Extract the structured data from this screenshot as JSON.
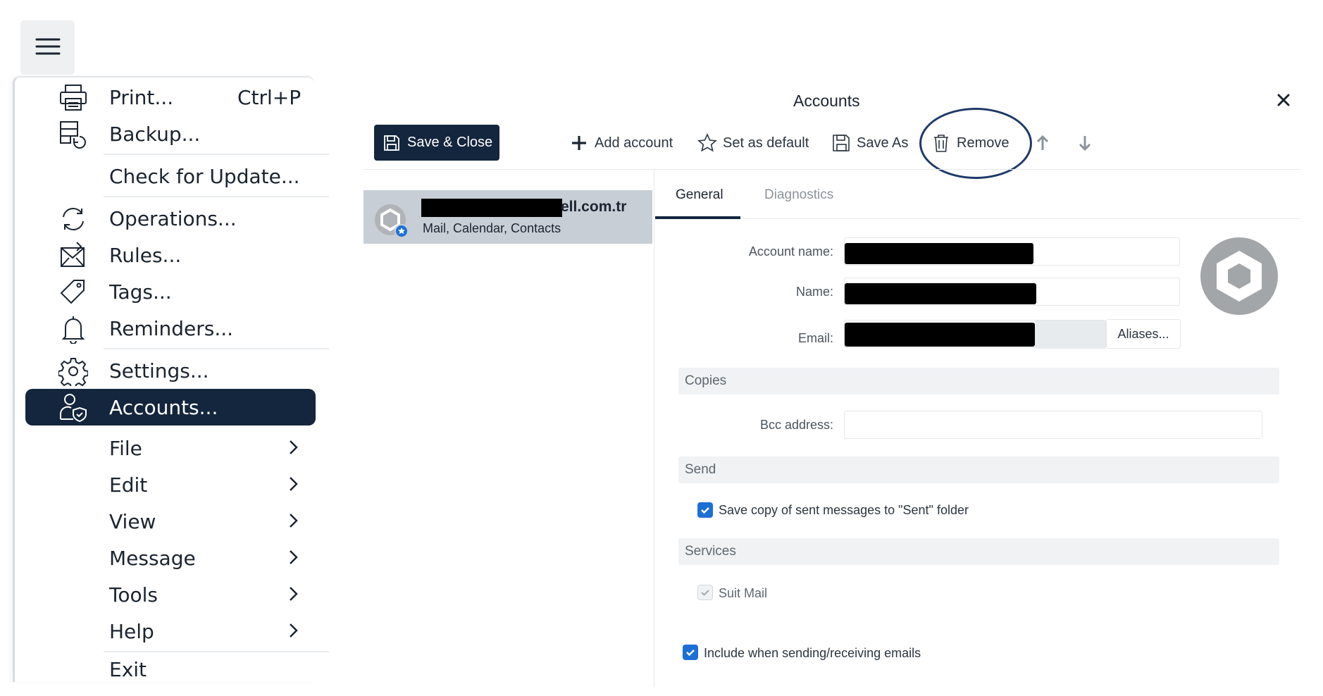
{
  "menu": {
    "items": [
      {
        "label": "Print...",
        "shortcut": "Ctrl+P",
        "icon": "printer-icon"
      },
      {
        "label": "Backup...",
        "icon": "backup-icon"
      },
      {
        "label": "Check for Update...",
        "icon": ""
      },
      {
        "label": "Operations...",
        "icon": "sync-icon"
      },
      {
        "label": "Rules...",
        "icon": "rules-icon"
      },
      {
        "label": "Tags...",
        "icon": "tag-icon"
      },
      {
        "label": "Reminders...",
        "icon": "bell-icon"
      },
      {
        "label": "Settings...",
        "icon": "gear-icon"
      },
      {
        "label": "Accounts...",
        "icon": "account-shield-icon"
      },
      {
        "label": "File"
      },
      {
        "label": "Edit"
      },
      {
        "label": "View"
      },
      {
        "label": "Message"
      },
      {
        "label": "Tools"
      },
      {
        "label": "Help"
      },
      {
        "label": "Exit"
      }
    ]
  },
  "dialog": {
    "title": "Accounts",
    "toolbar": {
      "save_close": "Save & Close",
      "add_account": "Add account",
      "set_default": "Set as default",
      "save_as": "Save As",
      "remove": "Remove"
    },
    "account": {
      "domain_suffix": "ell.com.tr",
      "services": "Mail, Calendar, Contacts"
    },
    "tabs": {
      "general": "General",
      "diagnostics": "Diagnostics"
    },
    "form": {
      "account_name_label": "Account name:",
      "name_label": "Name:",
      "email_label": "Email:",
      "aliases_button": "Aliases...",
      "copies_section": "Copies",
      "bcc_label": "Bcc address:",
      "send_section": "Send",
      "save_copy_label": "Save copy of sent messages to \"Sent\" folder",
      "services_section": "Services",
      "suit_mail_label": "Suit Mail",
      "include_label": "Include when sending/receiving emails"
    }
  },
  "colors": {
    "navy": "#13263d",
    "checkbox_blue": "#1d6fd6",
    "highlight_ring": "#1f3a68",
    "selected_row": "#c7ced6"
  }
}
